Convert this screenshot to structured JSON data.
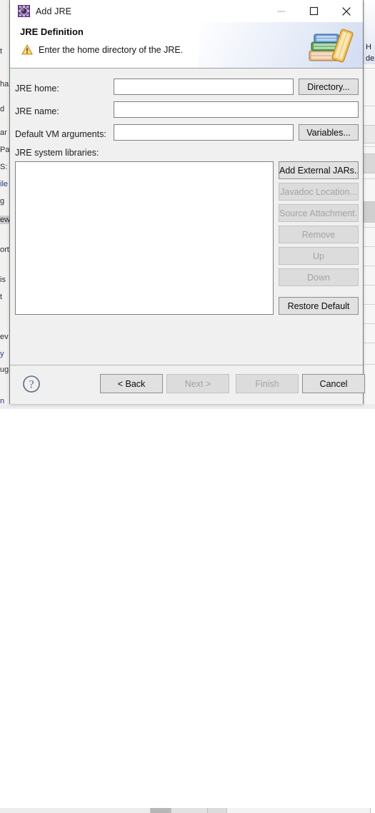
{
  "window": {
    "title": "Add JRE",
    "icon": "jre-gear-icon",
    "controls": {
      "minimize": {
        "name": "minimize-button",
        "enabled": false
      },
      "maximize": {
        "name": "maximize-button",
        "enabled": true
      },
      "close": {
        "name": "close-button",
        "enabled": true
      }
    }
  },
  "header": {
    "title": "JRE Definition",
    "message": "Enter the home directory of the JRE.",
    "status_icon": "warning-icon",
    "banner_icon": "books-icon",
    "warning_color": "#f0a929"
  },
  "form": {
    "jre_home": {
      "label": "JRE home:",
      "value": "",
      "placeholder": "",
      "button": {
        "label": "Directory...",
        "enabled": true
      }
    },
    "jre_name": {
      "label": "JRE name:",
      "value": "",
      "placeholder": ""
    },
    "vm_args": {
      "label": "Default VM arguments:",
      "value": "",
      "placeholder": "",
      "button": {
        "label": "Variables...",
        "enabled": true
      }
    },
    "libraries": {
      "label": "JRE system libraries:",
      "items": [],
      "buttons": [
        {
          "label": "Add External JARs...",
          "enabled": true
        },
        {
          "label": "Javadoc Location...",
          "enabled": false
        },
        {
          "label": "Source Attachment...",
          "enabled": false
        },
        {
          "label": "Remove",
          "enabled": false
        },
        {
          "label": "Up",
          "enabled": false
        },
        {
          "label": "Down",
          "enabled": false
        },
        {
          "label": "Restore Default",
          "enabled": true
        }
      ]
    }
  },
  "footer": {
    "help": {
      "name": "help-button",
      "icon": "question-mark-icon"
    },
    "buttons": [
      {
        "label": "< Back",
        "enabled": true
      },
      {
        "label": "Next >",
        "enabled": false
      },
      {
        "label": "Finish",
        "enabled": false
      },
      {
        "label": "Cancel",
        "enabled": true
      }
    ]
  },
  "background": {
    "left_fragments": [
      "t",
      "ha",
      "d",
      "ar",
      "Pa",
      "S:",
      "ile",
      "g",
      "ew",
      "ort",
      "is",
      "t",
      "ev",
      "y",
      "ug",
      "n"
    ],
    "right_fragments": [
      "H",
      "de"
    ]
  }
}
